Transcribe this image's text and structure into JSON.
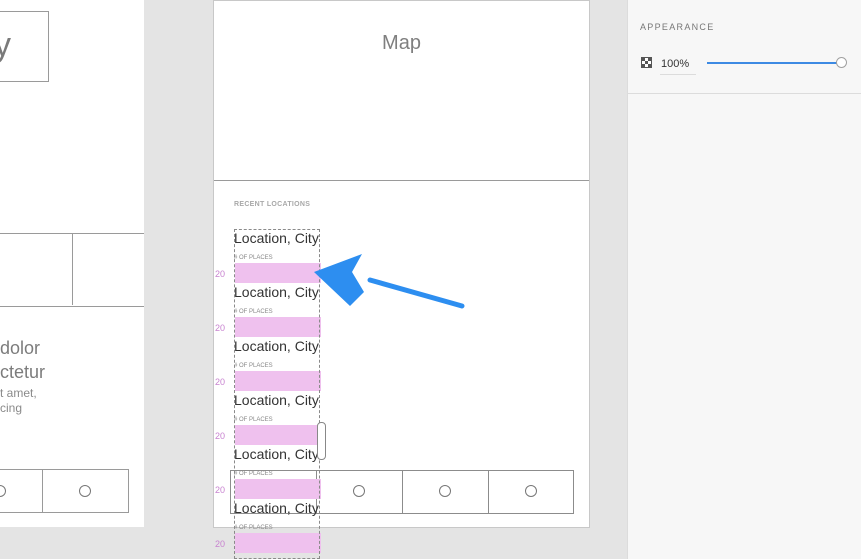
{
  "left_board": {
    "box_letter": "y",
    "headline": "dolor\nctetur",
    "body": "t amet,\ncing"
  },
  "main_board": {
    "map_label": "Map",
    "section_label": "RECENT LOCATIONS",
    "locations": [
      {
        "title": "Location, City",
        "sub": "# OF PLACES",
        "number": "20"
      },
      {
        "title": "Location, City",
        "sub": "# OF PLACES",
        "number": "20"
      },
      {
        "title": "Location, City",
        "sub": "# OF PLACES",
        "number": "20"
      },
      {
        "title": "Location, City",
        "sub": "# OF PLACES",
        "number": "20"
      },
      {
        "title": "Location, City",
        "sub": "# OF PLACES",
        "number": "20"
      },
      {
        "title": "Location, City",
        "sub": "# OF PLACES",
        "number": "20"
      }
    ]
  },
  "panel": {
    "section_title": "APPEARANCE",
    "opacity_value": "100%",
    "opacity_level": 1.0,
    "opacity_icon": "checkerboard-opacity-icon"
  },
  "annotation": {
    "icon": "blue-arrow-pointer",
    "color": "#2d8ef0"
  },
  "colors": {
    "highlight": "#efc1ee",
    "number": "#c883d0",
    "accent": "#3d8ae3"
  }
}
